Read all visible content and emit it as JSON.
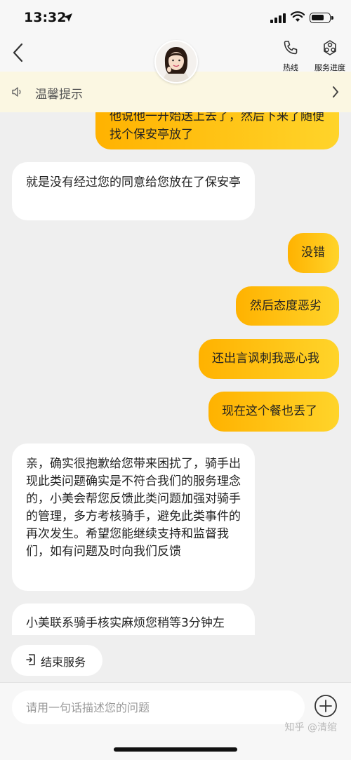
{
  "status": {
    "time": "13:32"
  },
  "header": {
    "actions": [
      {
        "label": "热线",
        "icon": "phone-icon"
      },
      {
        "label": "服务进度",
        "icon": "progress-icon"
      }
    ]
  },
  "notice": {
    "text": "温馨提示"
  },
  "messages": [
    {
      "from": "user",
      "text": "他说他一开始送上去了，然后下来了随便找个保安亭放了"
    },
    {
      "from": "agent",
      "text": "就是没有经过您的同意给您放在了保安亭"
    },
    {
      "from": "user",
      "text": "没错"
    },
    {
      "from": "user",
      "text": "然后态度恶劣"
    },
    {
      "from": "user",
      "text": "还出言讽刺我恶心我"
    },
    {
      "from": "user",
      "text": "现在这个餐也丢了"
    },
    {
      "from": "agent",
      "text": "亲，确实很抱歉给您带来困扰了，骑手出现此类问题确实是不符合我们的服务理念的，小美会帮您反馈此类问题加强对骑手的管理，多方考核骑手，避免此类事件的再次发生。希望您能继续支持和监督我们，如有问题及时向我们反馈"
    },
    {
      "from": "agent",
      "text": "小美联系骑手核实麻烦您稍等3分钟左"
    }
  ],
  "quick_action": {
    "label": "结束服务",
    "icon": "exit-icon"
  },
  "composer": {
    "placeholder": "请用一句话描述您的问题",
    "value": ""
  },
  "watermark": "知乎 @清绾",
  "colors": {
    "accent": "#ffc107",
    "notice_bg": "#fbf7e2"
  }
}
